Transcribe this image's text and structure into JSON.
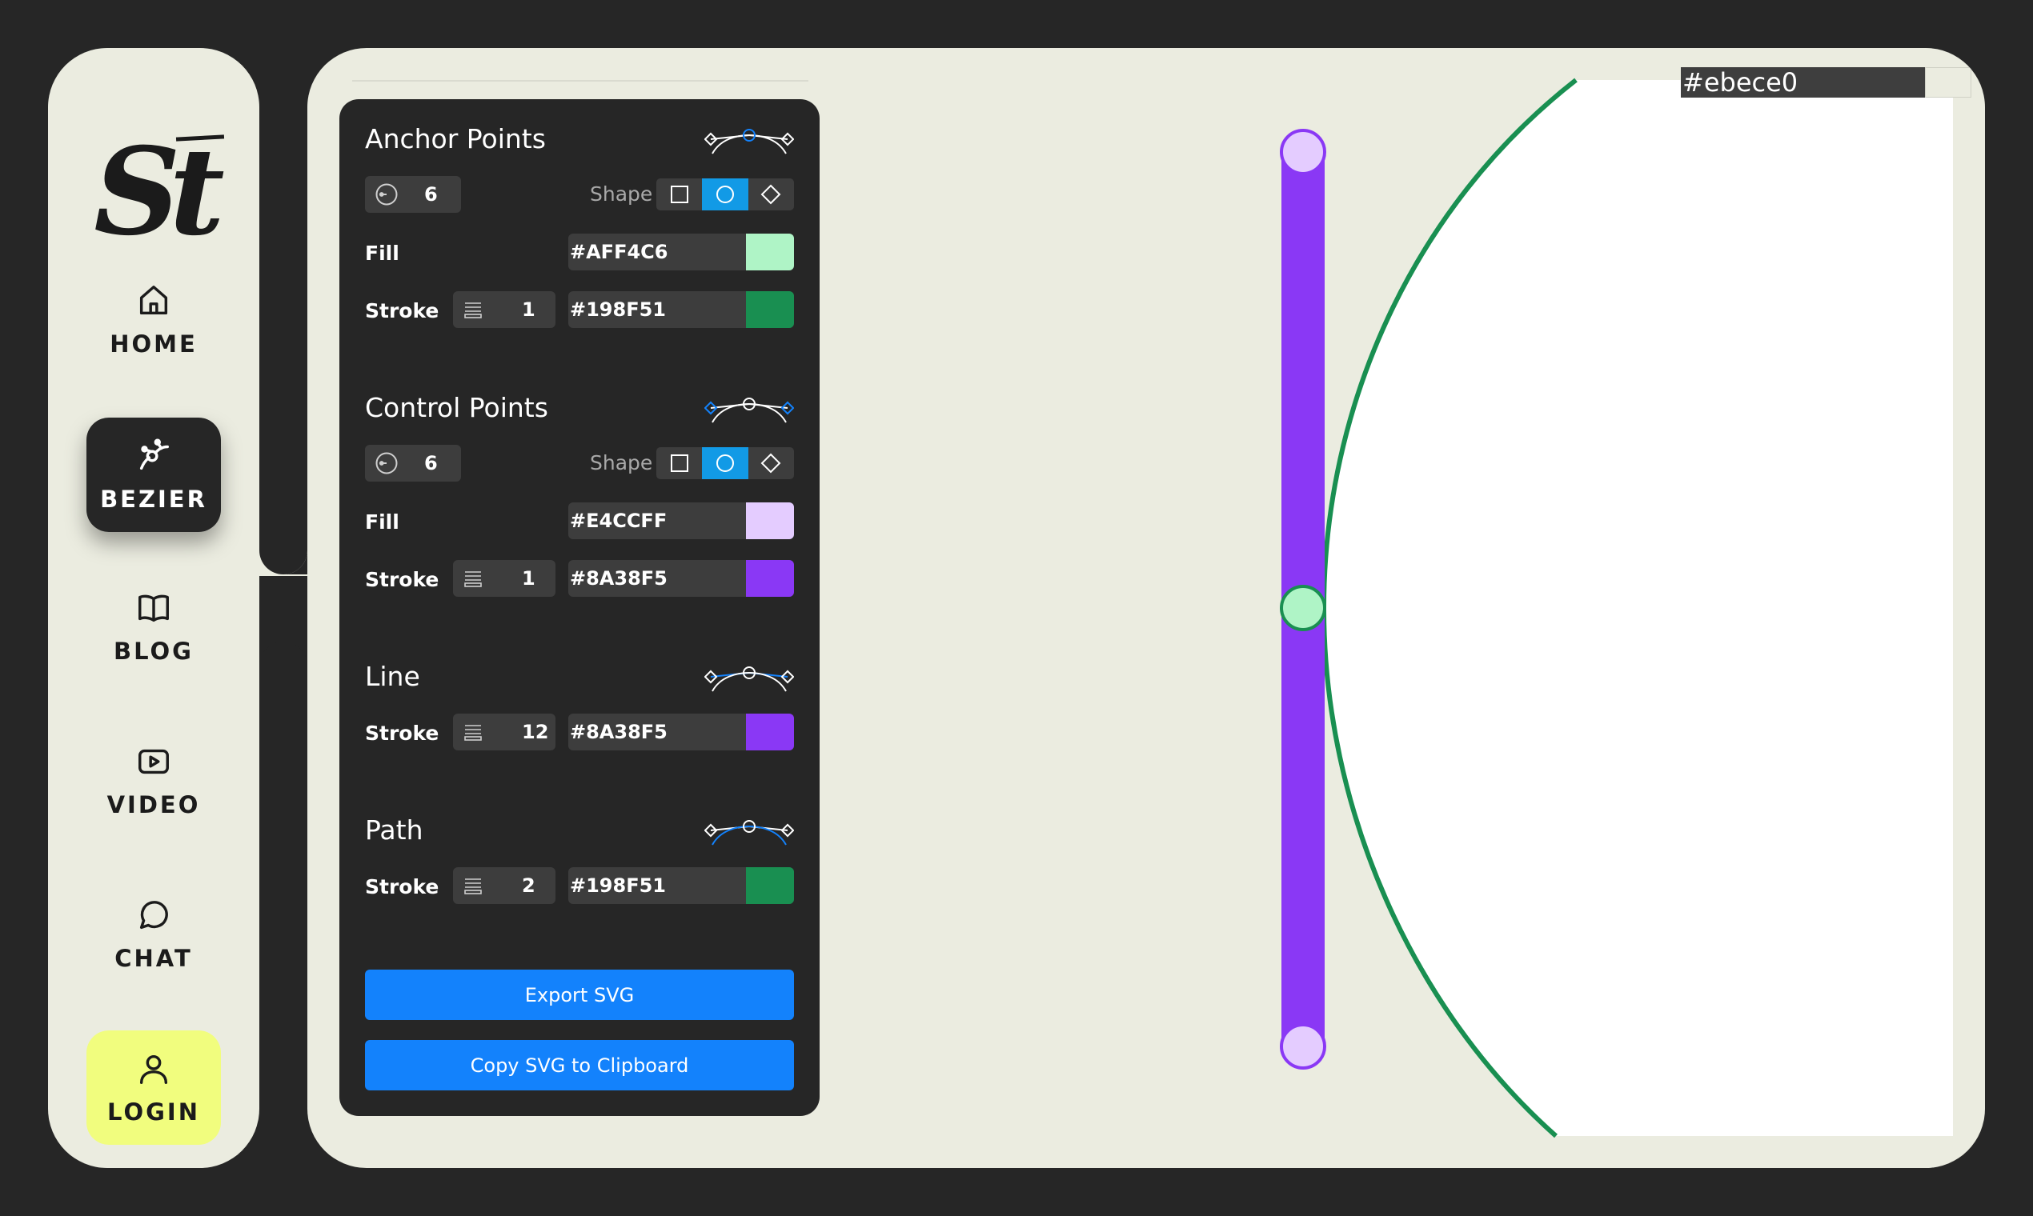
{
  "brand": {
    "logo_text": "St"
  },
  "nav": {
    "items": [
      {
        "label": "HOME",
        "icon": "home-icon"
      },
      {
        "label": "BEZIER",
        "icon": "bezier-icon",
        "active": true
      },
      {
        "label": "BLOG",
        "icon": "book-icon"
      },
      {
        "label": "VIDEO",
        "icon": "video-icon"
      },
      {
        "label": "CHAT",
        "icon": "chat-icon"
      },
      {
        "label": "LOGIN",
        "icon": "user-icon"
      }
    ]
  },
  "panel": {
    "anchor": {
      "title": "Anchor Points",
      "count": "6",
      "shape_label": "Shape",
      "fill_label": "Fill",
      "fill_hex": "#AFF4C6",
      "stroke_label": "Stroke",
      "stroke_width": "1",
      "stroke_hex": "#198F51"
    },
    "control": {
      "title": "Control Points",
      "count": "6",
      "shape_label": "Shape",
      "fill_label": "Fill",
      "fill_hex": "#E4CCFF",
      "stroke_label": "Stroke",
      "stroke_width": "1",
      "stroke_hex": "#8A38F5"
    },
    "line": {
      "title": "Line",
      "stroke_label": "Stroke",
      "stroke_width": "12",
      "stroke_hex": "#8A38F5"
    },
    "path": {
      "title": "Path",
      "stroke_label": "Stroke",
      "stroke_width": "2",
      "stroke_hex": "#198F51"
    },
    "export_label": "Export SVG",
    "copy_label": "Copy SVG to Clipboard"
  },
  "canvas": {
    "background_hex": "#ebece0",
    "colors": {
      "line": "#8A38F5",
      "path": "#198F51",
      "anchor_fill": "#AFF4C6",
      "control_fill": "#E4CCFF",
      "accent": "#129ae6",
      "button": "#1382fc"
    }
  }
}
